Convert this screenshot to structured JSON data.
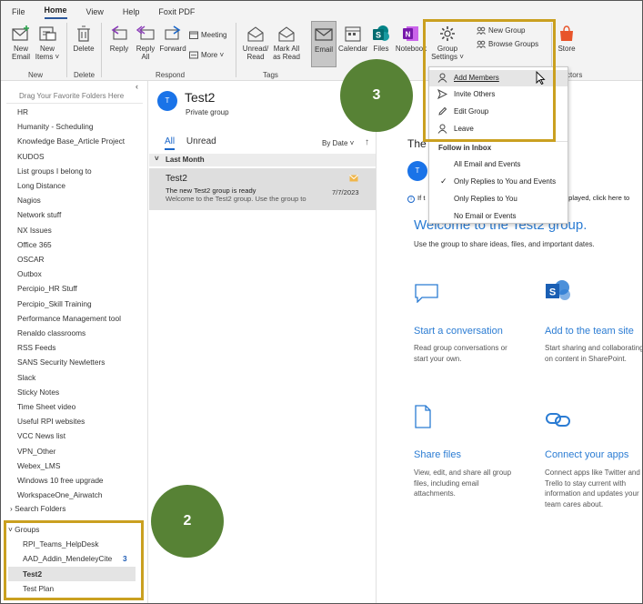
{
  "menu": {
    "tabs": [
      {
        "label": "File",
        "active": false
      },
      {
        "label": "Home",
        "active": true
      },
      {
        "label": "View",
        "active": false
      },
      {
        "label": "Help",
        "active": false
      },
      {
        "label": "Foxit PDF",
        "active": false
      }
    ]
  },
  "ribbon": {
    "new_group": {
      "label": "New",
      "new_email": "New\nEmail",
      "new_items": "New\nItems ˅"
    },
    "delete_group": {
      "label": "Delete",
      "delete": "Delete"
    },
    "respond_group": {
      "label": "Respond",
      "reply": "Reply",
      "reply_all": "Reply\nAll",
      "forward": "Forward",
      "meeting": "Meeting",
      "more": "More ˅"
    },
    "tags_group": {
      "label": "Tags",
      "unread_read": "Unread/\nRead",
      "mark_all_read": "Mark All\nas Read"
    },
    "apps": {
      "email": "Email",
      "calendar": "Calendar",
      "files": "Files",
      "notebook": "Notebook"
    },
    "group_settings": "Group\nSettings ˅",
    "new_group_btn": "New Group",
    "browse_groups": "Browse Groups",
    "store": "Store",
    "connectors_partial": "ctors"
  },
  "nav": {
    "collapse_glyph": "‹",
    "drag_hint": "Drag Your Favorite Folders Here",
    "folders": [
      "HR",
      "Humanity - Scheduling",
      "Knowledge Base_Article Project",
      "KUDOS",
      "List groups I belong to",
      "Long Distance",
      "Nagios",
      "Network stuff",
      "NX Issues",
      "Office 365",
      "OSCAR",
      "Outbox",
      "Percipio_HR Stuff",
      "Percipio_Skill Training",
      "Performance Management tool",
      "Renaldo classrooms",
      "RSS Feeds",
      "SANS Security Newletters",
      "Slack",
      "Sticky Notes",
      "Time Sheet video",
      "Useful RPI websites",
      "VCC  News list",
      "VPN_Other",
      "Webex_LMS",
      "Windows 10 free upgrade",
      "WorkspaceOne_Airwatch"
    ],
    "search_folders": "Search Folders",
    "groups_label": "Groups",
    "groups": [
      {
        "name": "RPI_Teams_HelpDesk",
        "count": "",
        "selected": false
      },
      {
        "name": "AAD_Addin_MendeleyCite",
        "count": "3",
        "selected": false
      },
      {
        "name": "Test2",
        "count": "",
        "selected": true
      },
      {
        "name": "Test Plan",
        "count": "",
        "selected": false
      }
    ]
  },
  "list": {
    "group_initial": "T",
    "group_name": "Test2",
    "group_type": "Private group",
    "tab_all": "All",
    "tab_unread": "Unread",
    "sort": "By Date ˅",
    "sort_arrow": "↑",
    "section": "Last Month",
    "message": {
      "from": "Test2",
      "subject": "The new Test2 group is ready",
      "preview": "Welcome to the Test2 group.  Use the group to",
      "date": "7/7/2023"
    }
  },
  "reading": {
    "header_partial": "The",
    "avatar_initial": "T",
    "info_partial": "If t",
    "info_tail": "displayed, click here to",
    "welcome": "Welcome to the Test2 group.",
    "welcome_sub": "Use the group to share ideas, files, and important dates.",
    "cards": [
      {
        "title": "Start a conversation",
        "desc": "Read group conversations or start your own."
      },
      {
        "title": "Add to the team site",
        "desc": "Start sharing and collaborating on content in SharePoint."
      },
      {
        "title": "Share files",
        "desc": "View, edit, and share all group files, including email attachments."
      },
      {
        "title": "Connect your apps",
        "desc": "Connect apps like Twitter and Trello to stay current with information and updates your team cares about."
      }
    ]
  },
  "dropdown": {
    "items": [
      "Add Members",
      "Invite Others",
      "Edit Group",
      "Leave"
    ],
    "follow_header": "Follow in Inbox",
    "follow_options": [
      {
        "label": "All Email and Events",
        "checked": false
      },
      {
        "label": "Only Replies to You and Events",
        "checked": true
      },
      {
        "label": "Only Replies to You",
        "checked": false
      },
      {
        "label": "No Email or Events",
        "checked": false
      }
    ]
  },
  "callouts": {
    "step2": "2",
    "step3": "3"
  },
  "colors": {
    "highlight": "#caa020",
    "callout": "#578235",
    "accent": "#2b7cd3"
  }
}
